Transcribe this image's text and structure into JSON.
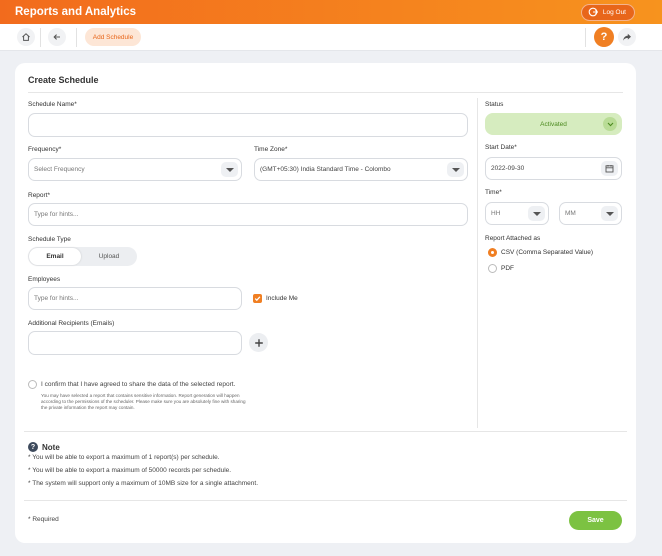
{
  "header": {
    "title": "Reports and Analytics",
    "logout_label": "Log Out"
  },
  "toolbar": {
    "add_schedule_label": "Add Schedule"
  },
  "form": {
    "title": "Create Schedule",
    "schedule_name": {
      "label": "Schedule Name*",
      "value": ""
    },
    "frequency": {
      "label": "Frequency*",
      "value": "Select Frequency"
    },
    "timezone": {
      "label": "Time Zone*",
      "value": "(GMT+05:30) India Standard Time - Colombo"
    },
    "report": {
      "label": "Report*",
      "placeholder": "Type for hints..."
    },
    "schedule_type": {
      "label": "Schedule Type",
      "options": [
        "Email",
        "Upload"
      ],
      "selected": "Email"
    },
    "employees": {
      "label": "Employees",
      "placeholder": "Type for hints..."
    },
    "include_me": {
      "label": "Include Me",
      "checked": true
    },
    "additional_recipients": {
      "label": "Additional Recipients (Emails)",
      "value": ""
    },
    "consent": {
      "label": "I confirm that I have agreed to share the data of the selected report.",
      "warning": "You may have selected a report that contains sensitive information. Report generation will happen according to the permissions of the scheduler. Please make sure you are absolutely fine with sharing the private information the report may contain."
    },
    "status": {
      "label": "Status",
      "value": "Activated"
    },
    "start_date": {
      "label": "Start Date*",
      "value": "2022-09-30"
    },
    "time": {
      "label": "Time*",
      "hour_placeholder": "HH",
      "minute_placeholder": "MM"
    },
    "report_attached": {
      "label": "Report Attached as",
      "options": [
        "CSV (Comma Separated Value)",
        "PDF"
      ],
      "selected": "CSV (Comma Separated Value)"
    }
  },
  "note": {
    "title": "Note",
    "items": [
      "* You will be able to export a maximum of 1 report(s) per schedule.",
      "* You will be able to export a maximum of 50000 records per schedule.",
      "* The system will support only a maximum of 10MB size for a single attachment."
    ]
  },
  "footer": {
    "required_label": "* Required",
    "save_label": "Save"
  },
  "colors": {
    "brand": "#f26b1d",
    "green": "#7cc242",
    "green_light": "#d6ecbf"
  }
}
